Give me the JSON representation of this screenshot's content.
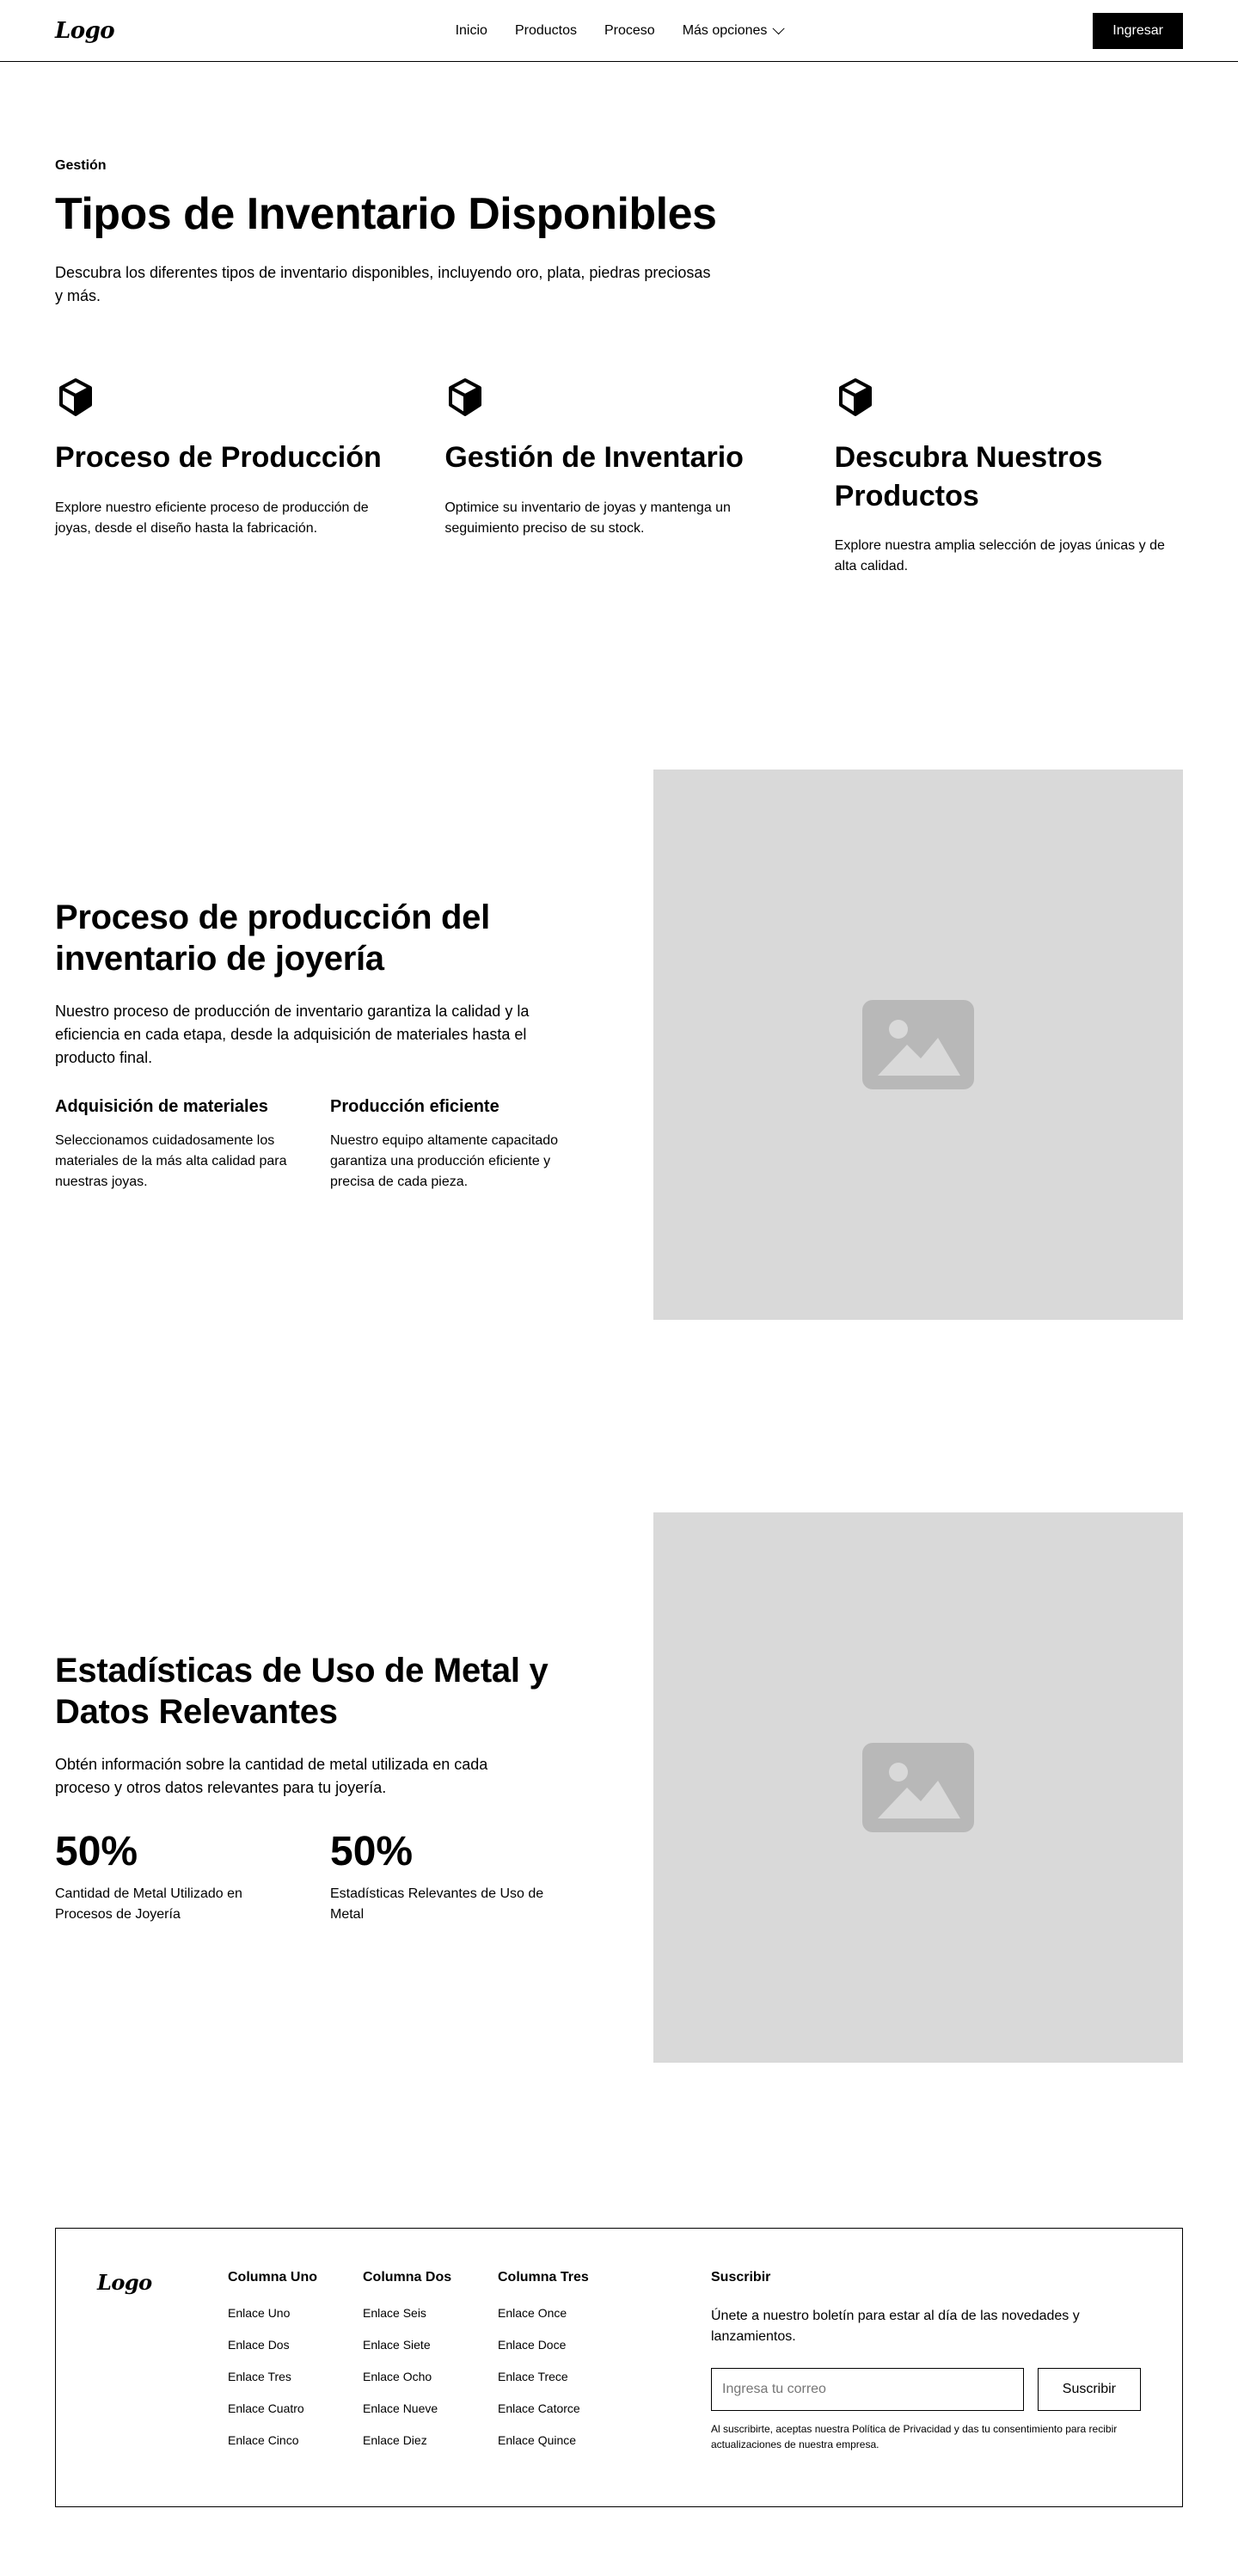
{
  "nav": {
    "logo": "Logo",
    "links": [
      "Inicio",
      "Productos",
      "Proceso",
      "Más opciones"
    ],
    "cta": "Ingresar"
  },
  "features_section": {
    "tagline": "Gestión",
    "title": "Tipos de Inventario Disponibles",
    "description": "Descubra los diferentes tipos de inventario disponibles, incluyendo oro, plata, piedras preciosas y más.",
    "items": [
      {
        "icon": "cube-icon",
        "title": "Proceso de Producción",
        "text": "Explore nuestro eficiente proceso de producción de joyas, desde el diseño hasta la fabricación."
      },
      {
        "icon": "cube-icon",
        "title": "Gestión de Inventario",
        "text": "Optimice su inventario de joyas y mantenga un seguimiento preciso de su stock."
      },
      {
        "icon": "cube-icon",
        "title": "Descubra Nuestros Productos",
        "text": "Explore nuestra amplia selección de joyas únicas y de alta calidad."
      }
    ]
  },
  "production_section": {
    "title": "Proceso de producción del inventario de joyería",
    "description": "Nuestro proceso de producción de inventario garantiza la calidad y la eficiencia en cada etapa, desde la adquisición de materiales hasta el producto final.",
    "items": [
      {
        "title": "Adquisición de materiales",
        "text": "Seleccionamos cuidadosamente los materiales de la más alta calidad para nuestras joyas."
      },
      {
        "title": "Producción eficiente",
        "text": "Nuestro equipo altamente capacitado garantiza una producción eficiente y precisa de cada pieza."
      }
    ]
  },
  "stats_section": {
    "title": "Estadísticas de Uso de Metal y Datos Relevantes",
    "description": "Obtén información sobre la cantidad de metal utilizada en cada proceso y otros datos relevantes para tu joyería.",
    "stats": [
      {
        "value": "50%",
        "label": "Cantidad de Metal Utilizado en Procesos de Joyería"
      },
      {
        "value": "50%",
        "label": "Estadísticas Relevantes de Uso de Metal"
      }
    ]
  },
  "footer": {
    "logo": "Logo",
    "columns": [
      {
        "title": "Columna Uno",
        "links": [
          "Enlace Uno",
          "Enlace Dos",
          "Enlace Tres",
          "Enlace Cuatro",
          "Enlace Cinco"
        ]
      },
      {
        "title": "Columna Dos",
        "links": [
          "Enlace Seis",
          "Enlace Siete",
          "Enlace Ocho",
          "Enlace Nueve",
          "Enlace Diez"
        ]
      },
      {
        "title": "Columna Tres",
        "links": [
          "Enlace Once",
          "Enlace Doce",
          "Enlace Trece",
          "Enlace Catorce",
          "Enlace Quince"
        ]
      }
    ],
    "subscribe": {
      "title": "Suscribir",
      "description": "Únete a nuestro boletín para estar al día de las novedades y lanzamientos.",
      "placeholder": "Ingresa tu correo",
      "button": "Suscribir",
      "legal": "Al suscribirte, aceptas nuestra Política de Privacidad y das tu consentimiento para recibir actualizaciones de nuestra empresa."
    }
  }
}
